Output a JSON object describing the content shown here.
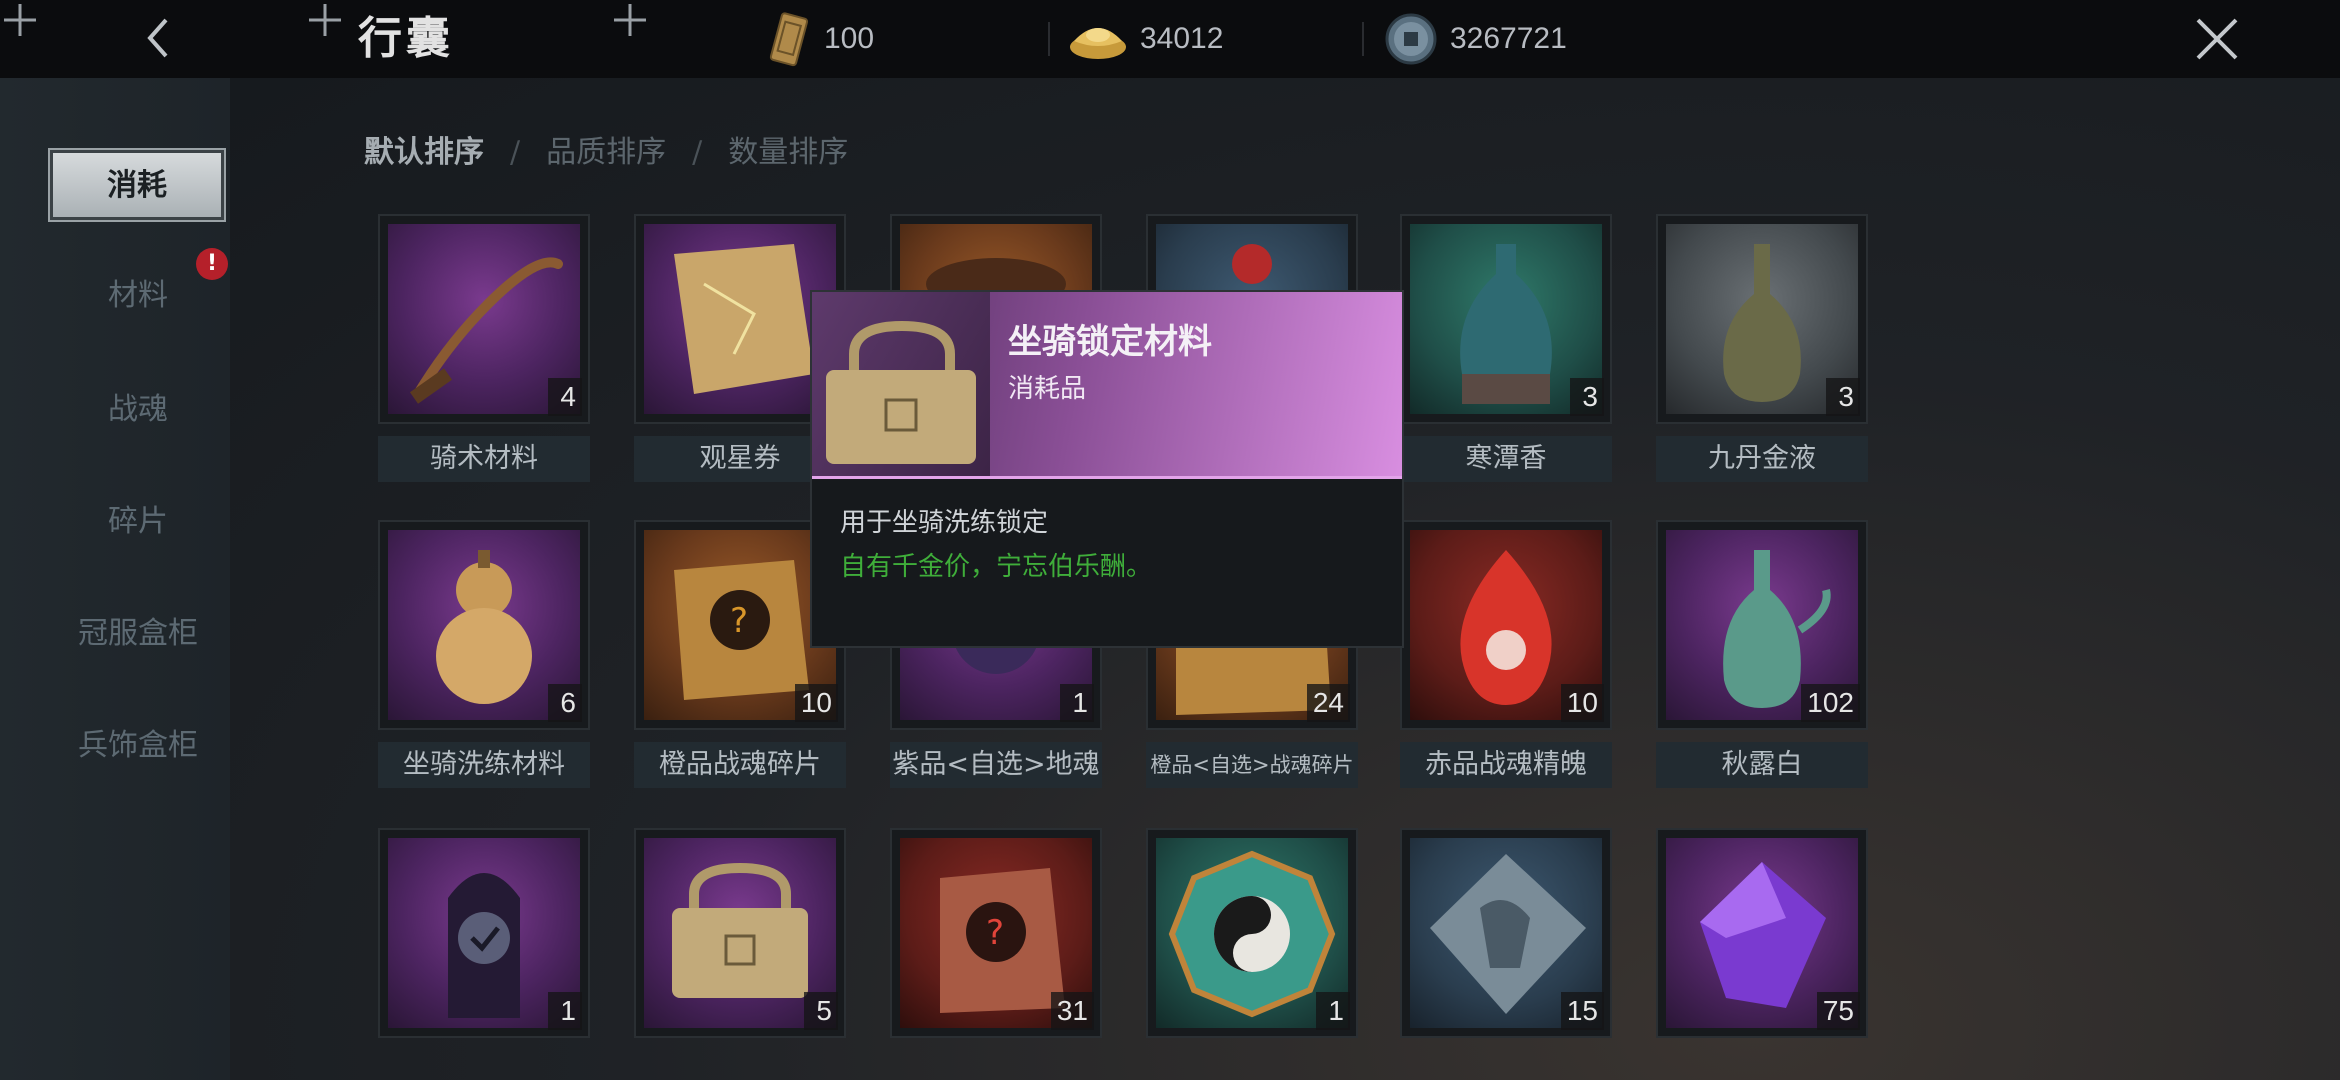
{
  "header": {
    "title": "行囊",
    "currencies": [
      {
        "icon": "token-icon",
        "value": "100"
      },
      {
        "icon": "gold-ingot-icon",
        "value": "34012"
      },
      {
        "icon": "coin-icon",
        "value": "3267721"
      }
    ]
  },
  "sidebar": {
    "items": [
      {
        "label": "消耗",
        "active": true
      },
      {
        "label": "材料",
        "badge": "!"
      },
      {
        "label": "战魂"
      },
      {
        "label": "碎片"
      },
      {
        "label": "冠服盒柜"
      },
      {
        "label": "兵饰盒柜"
      }
    ]
  },
  "sort": {
    "options": [
      "默认排序",
      "品质排序",
      "数量排序"
    ],
    "separator": "/"
  },
  "items": [
    {
      "name": "骑术材料",
      "count": "4",
      "icon": "whip-icon",
      "quality": "purple"
    },
    {
      "name": "观星券",
      "count": "",
      "icon": "scroll-icon",
      "quality": "purple"
    },
    {
      "name": "",
      "count": "",
      "icon": "hat-icon",
      "quality": "orange"
    },
    {
      "name": "",
      "count": "",
      "icon": "pouch-icon",
      "quality": "blue"
    },
    {
      "name": "寒潭香",
      "count": "3",
      "icon": "teal-vase-icon",
      "quality": "teal"
    },
    {
      "name": "九丹金液",
      "count": "3",
      "icon": "olive-vase-icon",
      "quality": "gray"
    },
    {
      "name": "坐骑洗练材料",
      "count": "6",
      "icon": "gourd-icon",
      "quality": "purple"
    },
    {
      "name": "橙品战魂碎片",
      "count": "10",
      "icon": "orange-puzzle-icon",
      "quality": "orange"
    },
    {
      "name": "紫品<自选>地魂",
      "count": "1",
      "icon": "soul-icon",
      "quality": "purple"
    },
    {
      "name": "橙品<自选>战魂碎片",
      "count": "24",
      "icon": "orange-puzzle-icon",
      "quality": "orange"
    },
    {
      "name": "赤品战魂精魄",
      "count": "10",
      "icon": "red-flame-icon",
      "quality": "red"
    },
    {
      "name": "秋露白",
      "count": "102",
      "icon": "jade-ewer-icon",
      "quality": "purple"
    },
    {
      "name": "",
      "count": "1",
      "icon": "soul-check-icon",
      "quality": "purple"
    },
    {
      "name": "",
      "count": "5",
      "icon": "padlock-icon",
      "quality": "purple"
    },
    {
      "name": "",
      "count": "31",
      "icon": "red-puzzle-icon",
      "quality": "red"
    },
    {
      "name": "",
      "count": "1",
      "icon": "bagua-icon",
      "quality": "teal"
    },
    {
      "name": "",
      "count": "15",
      "icon": "horse-puzzle-icon",
      "quality": "blue"
    },
    {
      "name": "",
      "count": "75",
      "icon": "purple-gem-icon",
      "quality": "purple"
    }
  ],
  "tooltip": {
    "icon": "padlock-icon",
    "name": "坐骑锁定材料",
    "type": "消耗品",
    "description": "用于坐骑洗练锁定",
    "flavor": "自有千金价，宁忘伯乐酬。",
    "colors": {
      "header": "#c77fd0",
      "flavor": "#3fae3a"
    }
  }
}
